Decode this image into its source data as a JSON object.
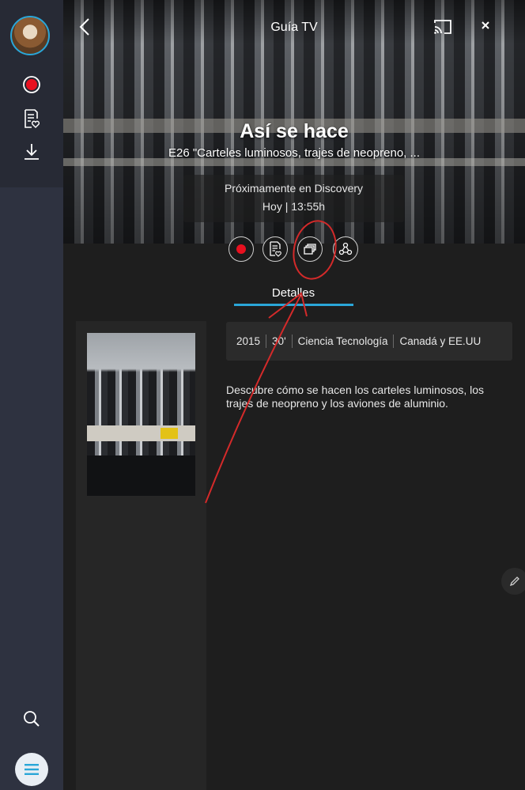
{
  "header": {
    "title": "Guía TV",
    "icons": [
      "back-icon",
      "cast-icon",
      "close-icon"
    ]
  },
  "sidebar": {
    "icons": [
      "avatar",
      "record-icon",
      "watchlist-icon",
      "download-icon",
      "search-icon",
      "menu-icon"
    ]
  },
  "program": {
    "title": "Así se hace",
    "episode": "E26 \"Carteles luminosos, trajes de neopreno, ...",
    "channel_line": "Próximamente en Discovery",
    "time_line": "Hoy | 13:55h"
  },
  "actions": [
    "record-icon",
    "watchlist-icon",
    "multiscreen-icon",
    "share-icon"
  ],
  "tabs": [
    {
      "label": "Detalles"
    }
  ],
  "details": {
    "meta": [
      "2015",
      "30'",
      "Ciencia Tecnología",
      "Canadá y EE.UU"
    ],
    "description": "Descubre cómo se hacen los carteles luminosos, los trajes de neopreno y los aviones de aluminio."
  },
  "colors": {
    "accent": "#2aa6d8",
    "record": "#e8101f",
    "annotation": "#d42a2a",
    "sidebar": "#2e3240"
  }
}
